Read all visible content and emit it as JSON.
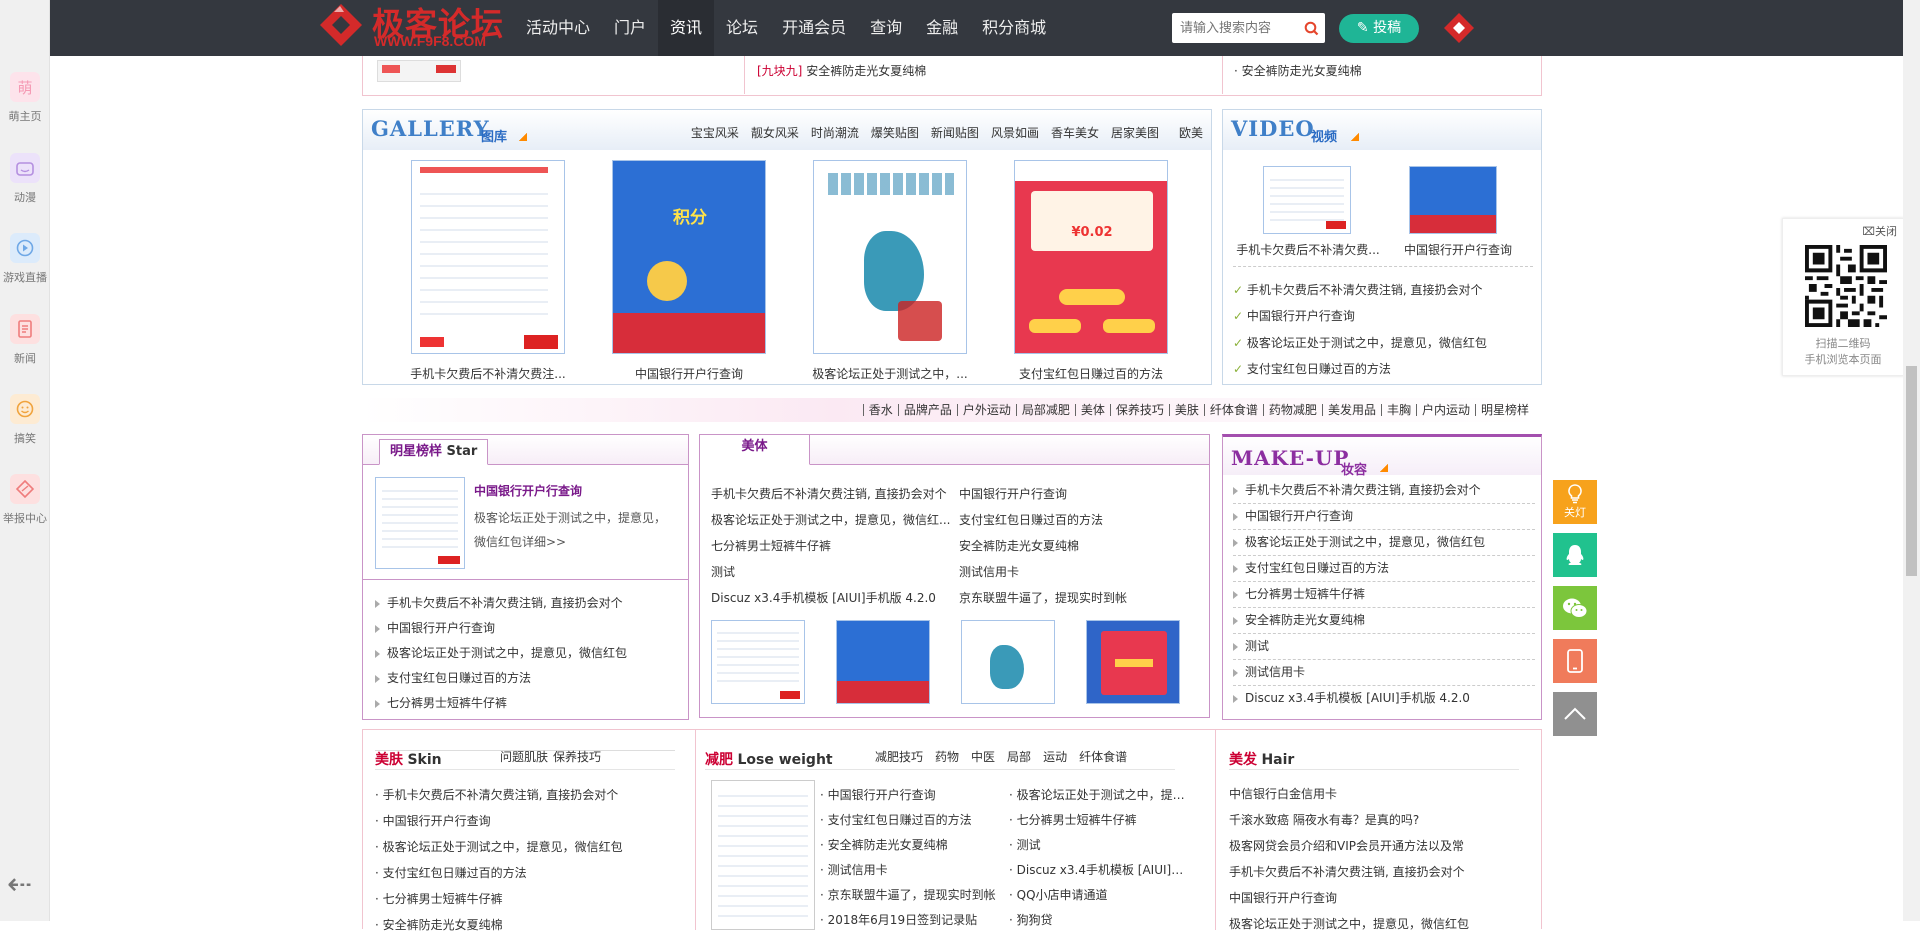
{
  "sidebar": {
    "items": [
      {
        "label": "萌主页",
        "icon": "萌",
        "color": "#f7b8cc",
        "bg": "#fde3eb"
      },
      {
        "label": "动漫",
        "icon": "cat-face-icon",
        "color": "#b48fe0",
        "bg": "#ece2fa"
      },
      {
        "label": "游戏直播",
        "icon": "play-icon",
        "color": "#6fa8e6",
        "bg": "#dcebfb"
      },
      {
        "label": "新闻",
        "icon": "news-icon",
        "color": "#ef7c7c",
        "bg": "#fde0e0"
      },
      {
        "label": "搞笑",
        "icon": "smile-icon",
        "color": "#f0a33d",
        "bg": "#fdebd3"
      },
      {
        "label": "举报中心",
        "icon": "report-icon",
        "color": "#ef7c7c",
        "bg": "#fde0e0"
      }
    ]
  },
  "header": {
    "logo_name": "极客论坛",
    "logo_url": "WWW.F9F8.COM",
    "nav": [
      "活动中心",
      "门户",
      "资讯",
      "论坛",
      "开通会员",
      "查询",
      "金融",
      "积分商城"
    ],
    "active_nav": "资讯",
    "search_placeholder": "请输入搜索内容",
    "post_label": "投稿"
  },
  "top_strip": {
    "mid_tag": "[九块九]",
    "mid_text": "安全裤防走光女夏纯棉",
    "right_text": "· 安全裤防走光女夏纯棉"
  },
  "gallery": {
    "title": "GALLERY",
    "subtitle": "图库",
    "links": [
      "宝宝风采",
      "靓女风采",
      "时尚潮流",
      "爆笑贴图",
      "新闻贴图",
      "风景如画",
      "香车美女",
      "居家美图",
      "欧美"
    ],
    "items": [
      {
        "caption": "手机卡欠费后不补清欠费注..."
      },
      {
        "caption": "中国银行开户行查询"
      },
      {
        "caption": "极客论坛正处于测试之中，..."
      },
      {
        "caption": "支付宝红包日赚过百的方法"
      }
    ]
  },
  "video": {
    "title": "VIDEO",
    "subtitle": "视频",
    "thumbs": [
      {
        "caption": "手机卡欠费后不补清欠费..."
      },
      {
        "caption": "中国银行开户行查询"
      }
    ],
    "list": [
      "手机卡欠费后不补清欠费注销, 直接扔会对个",
      "中国银行开户行查询",
      "极客论坛正处于测试之中，提意见，微信红包",
      "支付宝红包日赚过百的方法"
    ]
  },
  "tags": [
    "香水",
    "品牌产品",
    "户外运动",
    "局部减肥",
    "美体",
    "保养技巧",
    "美肤",
    "纤体食谱",
    "药物减肥",
    "美发用品",
    "丰胸",
    "户内运动",
    "明星榜样"
  ],
  "star": {
    "tab": "明星榜样 Star",
    "tab_cn": "明星榜样",
    "tab_en": "Star",
    "headline": "中国银行开户行查询",
    "desc": "极客论坛正处于测试之中，提意见，微信红包详细>>",
    "list": [
      "手机卡欠费后不补清欠费注销, 直接扔会对个",
      "中国银行开户行查询",
      "极客论坛正处于测试之中，提意见，微信红包",
      "支付宝红包日赚过百的方法",
      "七分裤男士短裤牛仔裤"
    ]
  },
  "body": {
    "tab": "美体",
    "left": [
      "手机卡欠费后不补清欠费注销, 直接扔会对个",
      "极客论坛正处于测试之中，提意见，微信红...",
      "七分裤男士短裤牛仔裤",
      "测试",
      "Discuz x3.4手机模板 [AIUI]手机版 4.2.0"
    ],
    "right": [
      "中国银行开户行查询",
      "支付宝红包日赚过百的方法",
      "安全裤防走光女夏纯棉",
      "测试信用卡",
      "京东联盟牛逼了，提现实时到帐"
    ]
  },
  "makeup": {
    "title": "MAKE-UP",
    "subtitle": "妆容",
    "list": [
      "手机卡欠费后不补清欠费注销, 直接扔会对个",
      "中国银行开户行查询",
      "极客论坛正处于测试之中，提意见，微信红包",
      "支付宝红包日赚过百的方法",
      "七分裤男士短裤牛仔裤",
      "安全裤防走光女夏纯棉",
      "测试",
      "测试信用卡",
      "Discuz x3.4手机模板 [AIUI]手机版 4.2.0"
    ]
  },
  "skin": {
    "title_cn": "美肤",
    "title_en": "Skin",
    "links": [
      "问题肌肤",
      "保养技巧"
    ],
    "list": [
      "· 手机卡欠费后不补清欠费注销, 直接扔会对个",
      "· 中国银行开户行查询",
      "· 极客论坛正处于测试之中，提意见，微信红包",
      "· 支付宝红包日赚过百的方法",
      "· 七分裤男士短裤牛仔裤",
      "· 安全裤防走光女夏纯棉"
    ]
  },
  "weight": {
    "title_cn": "减肥",
    "title_en": "Lose weight",
    "links": [
      "减肥技巧",
      "药物",
      "中医",
      "局部",
      "运动",
      "纤体食谱"
    ],
    "left": [
      "· 中国银行开户行查询",
      "· 支付宝红包日赚过百的方法",
      "· 安全裤防走光女夏纯棉",
      "· 测试信用卡",
      "· 京东联盟牛逼了，提现实时到帐",
      "· 2018年6月19日签到记录贴"
    ],
    "right": [
      "· 极客论坛正处于测试之中，提意...",
      "· 七分裤男士短裤牛仔裤",
      "· 测试",
      "· Discuz x3.4手机模板 [AIUI]手...",
      "· QQ小店申请通道",
      "· 狗狗贷"
    ]
  },
  "hair": {
    "title_cn": "美发",
    "title_en": "Hair",
    "list": [
      "中信银行白金信用卡",
      "千滚水致癌 隔夜水有毒？是真的吗?",
      "极客网贷会员介绍和VIP会员开通方法以及常",
      "手机卡欠费后不补清欠费注销, 直接扔会对个",
      "中国银行开户行查询",
      "极客论坛正处于测试之中，提意见，微信红包"
    ]
  },
  "qr_panel": {
    "close": "关闭",
    "line1": "扫描二维码",
    "line2": "手机浏览本页面"
  },
  "float_buttons": [
    {
      "label": "关灯",
      "color": "#f7a21c",
      "icon": "bulb-icon"
    },
    {
      "label": "",
      "color": "#21c28e",
      "icon": "qq-icon"
    },
    {
      "label": "",
      "color": "#7cc63c",
      "icon": "wechat-icon"
    },
    {
      "label": "",
      "color": "#f07b5b",
      "icon": "phone-icon"
    },
    {
      "label": "",
      "color": "#909090",
      "icon": "chevron-up-icon"
    }
  ]
}
